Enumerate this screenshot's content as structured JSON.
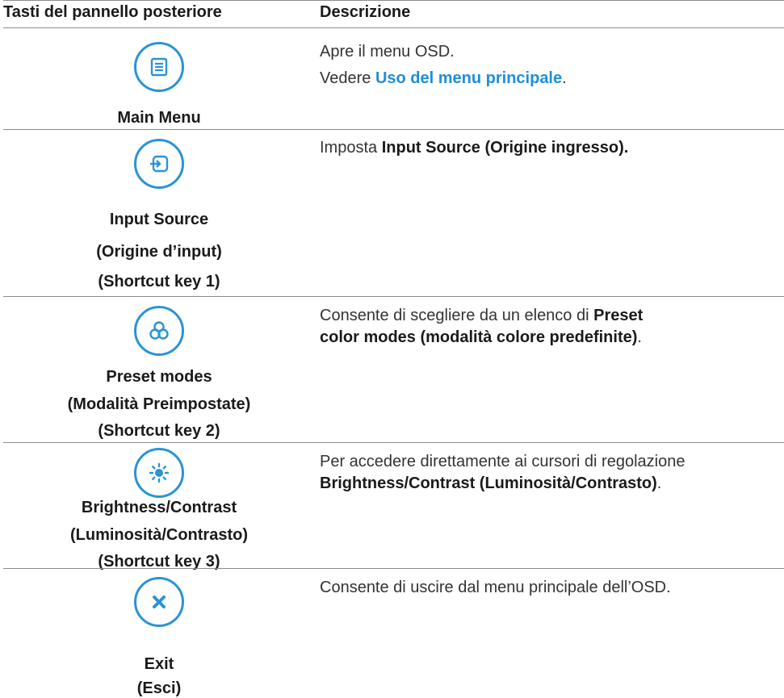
{
  "header": {
    "col_keys": "Tasti del pannello posteriore",
    "col_desc": "Descrizione"
  },
  "rows": [
    {
      "icon": "menu-list-icon",
      "labels": [
        "Main Menu"
      ],
      "desc_line1": "Apre il menu OSD.",
      "desc_line2_prefix": "Vedere ",
      "desc_line2_link": "Uso del menu principale",
      "desc_line2_suffix": "."
    },
    {
      "icon": "input-source-icon",
      "labels": [
        "Input Source",
        "(Origine d’input)",
        "(Shortcut key 1)"
      ],
      "desc_prefix": "Imposta ",
      "desc_bold": "Input Source (Origine ingresso)."
    },
    {
      "icon": "color-modes-icon",
      "labels": [
        "Preset modes",
        "(Modalità Preimpostate)",
        "(Shortcut key 2)"
      ],
      "desc_prefix": "Consente di scegliere da un elenco di ",
      "desc_bold_1": "Preset",
      "desc_bold_2": "color modes (modalità colore predefinite)",
      "desc_suffix": "."
    },
    {
      "icon": "brightness-icon",
      "labels": [
        "Brightness/Contrast",
        "(Luminosità/Contrasto)",
        "(Shortcut key 3)"
      ],
      "desc_line1": "Per accedere direttamente ai cursori di regolazione",
      "desc_bold": "Brightness/Contrast (Luminosità/Contrasto)",
      "desc_suffix": "."
    },
    {
      "icon": "close-icon",
      "labels": [
        "Exit",
        "(Esci)"
      ],
      "desc_line1": "Consente di uscire dal menu principale dell’OSD."
    }
  ],
  "colors": {
    "icon_accent": "#2a93d6",
    "link": "#1f8ddb",
    "rule": "#8c8c8c"
  }
}
